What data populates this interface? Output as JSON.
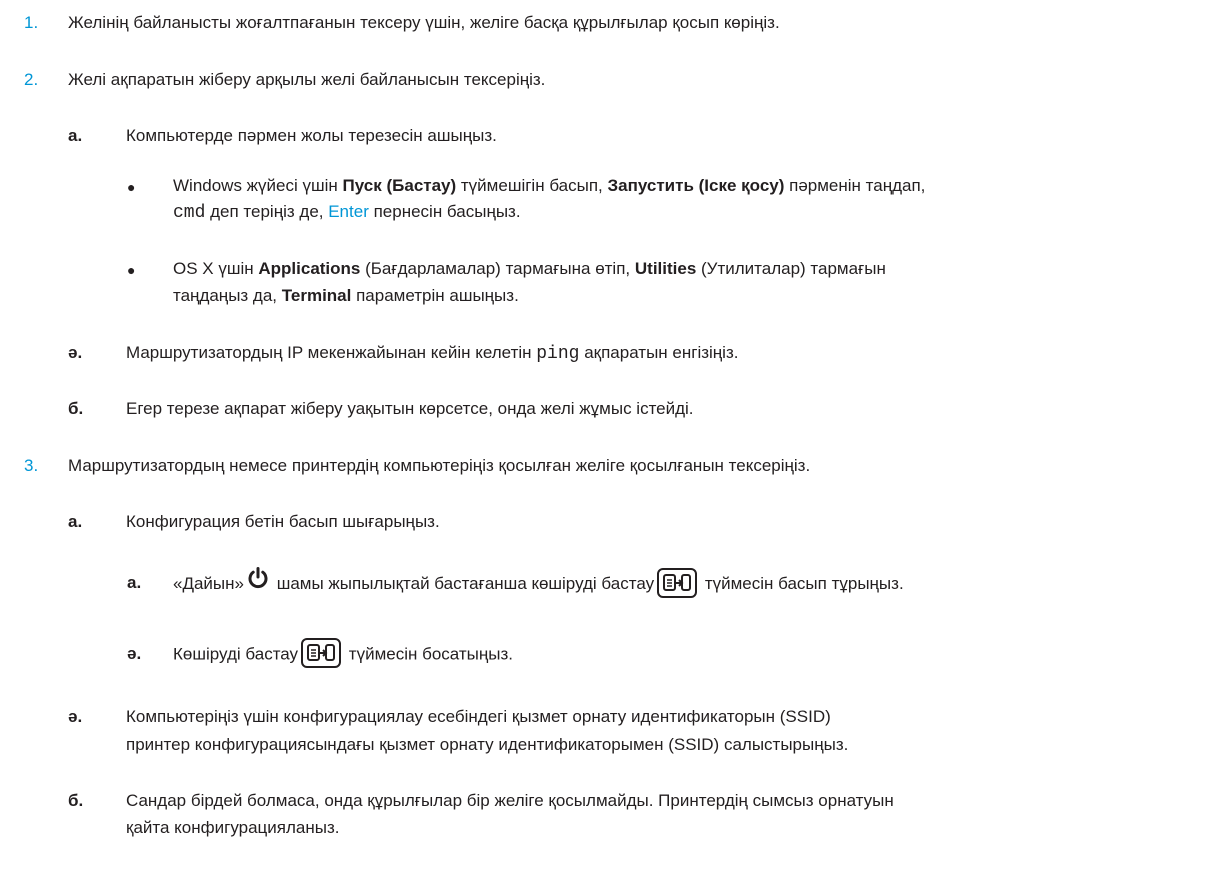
{
  "items": [
    {
      "marker": "1.",
      "text": "Желінің байланысты жоғалтпағанын тексеру үшін, желіге басқа құрылғылар қосып көріңіз."
    },
    {
      "marker": "2.",
      "text": "Желі ақпаратын жіберу арқылы желі байланысын тексеріңіз."
    },
    {
      "marker": "а.",
      "text": "Компьютерде пәрмен жолы терезесін ашыңыз."
    },
    {
      "marker": "●",
      "p1": "Windows жүйесі үшін ",
      "b1": "Пуск (Бастау)",
      "p2": " түймешігін басып, ",
      "b2": "Запустить (Іске қосу)",
      "p3": " пәрменін таңдап,",
      "code": "cmd",
      "p4": " деп теріңіз де, ",
      "key": "Enter",
      "p5": " пернесін басыңыз."
    },
    {
      "marker": "●",
      "p1": "OS X үшін ",
      "b1": "Applications",
      "p2": " (Бағдарламалар) тармағына өтіп, ",
      "b2": "Utilities",
      "p3": " (Утилиталар) тармағын",
      "p4": "таңдаңыз да, ",
      "b3": "Terminal",
      "p5": " параметрін ашыңыз."
    },
    {
      "marker": "ә.",
      "p1": "Маршрутизатордың IP мекенжайынан кейін келетін ",
      "code": "ping",
      "p2": " ақпаратын енгізіңіз."
    },
    {
      "marker": "б.",
      "text": "Егер терезе ақпарат жіберу уақытын көрсетсе, онда желі жұмыс істейді."
    },
    {
      "marker": "3.",
      "text": "Маршрутизатордың немесе принтердің компьютеріңіз қосылған желіге қосылғанын тексеріңіз."
    },
    {
      "marker": "а.",
      "text": "Конфигурация бетін басып шығарыңыз."
    },
    {
      "marker": "а.",
      "p1": "«Дайын»",
      "p2": " шамы жыпылықтай бастағанша көшіруді бастау",
      "p3": " түймесін басып тұрыңыз."
    },
    {
      "marker": "ә.",
      "p1": "Көшіруді бастау",
      "p2": " түймесін босатыңыз."
    },
    {
      "marker": "ә.",
      "line1": "Компьютеріңіз үшін конфигурациялау есебіндегі қызмет орнату идентификаторын (SSID)",
      "line2": "принтер конфигурациясындағы қызмет орнату идентификаторымен (SSID) салыстырыңыз."
    },
    {
      "marker": "б.",
      "line1": "Сандар бірдей болмаса, онда құрылғылар бір желіге қосылмайды. Принтердің сымсыз орнатуын",
      "line2": "қайта конфигурацияланыз."
    }
  ],
  "icons": {
    "power": "power-icon",
    "copy_start": "start-copy-icon"
  },
  "colors": {
    "accent": "#0096d6",
    "text": "#231f20"
  }
}
